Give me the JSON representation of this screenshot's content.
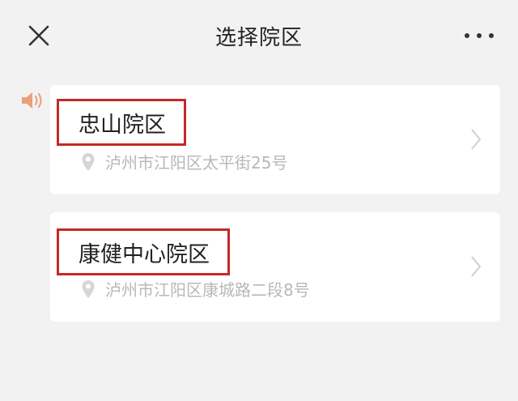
{
  "header": {
    "title": "选择院区",
    "close_icon": "close-icon",
    "more_icon": "more-icon"
  },
  "speaker_icon": "speaker-icon",
  "campuses": [
    {
      "name": "忠山院区",
      "address": "泸州市江阳区太平街25号"
    },
    {
      "name": "康健中心院区",
      "address": "泸州市江阳区康城路二段8号"
    }
  ],
  "colors": {
    "highlight_border": "#c62828",
    "background": "#f2f2f2",
    "card": "#ffffff",
    "address_text": "#b8b8b8"
  }
}
